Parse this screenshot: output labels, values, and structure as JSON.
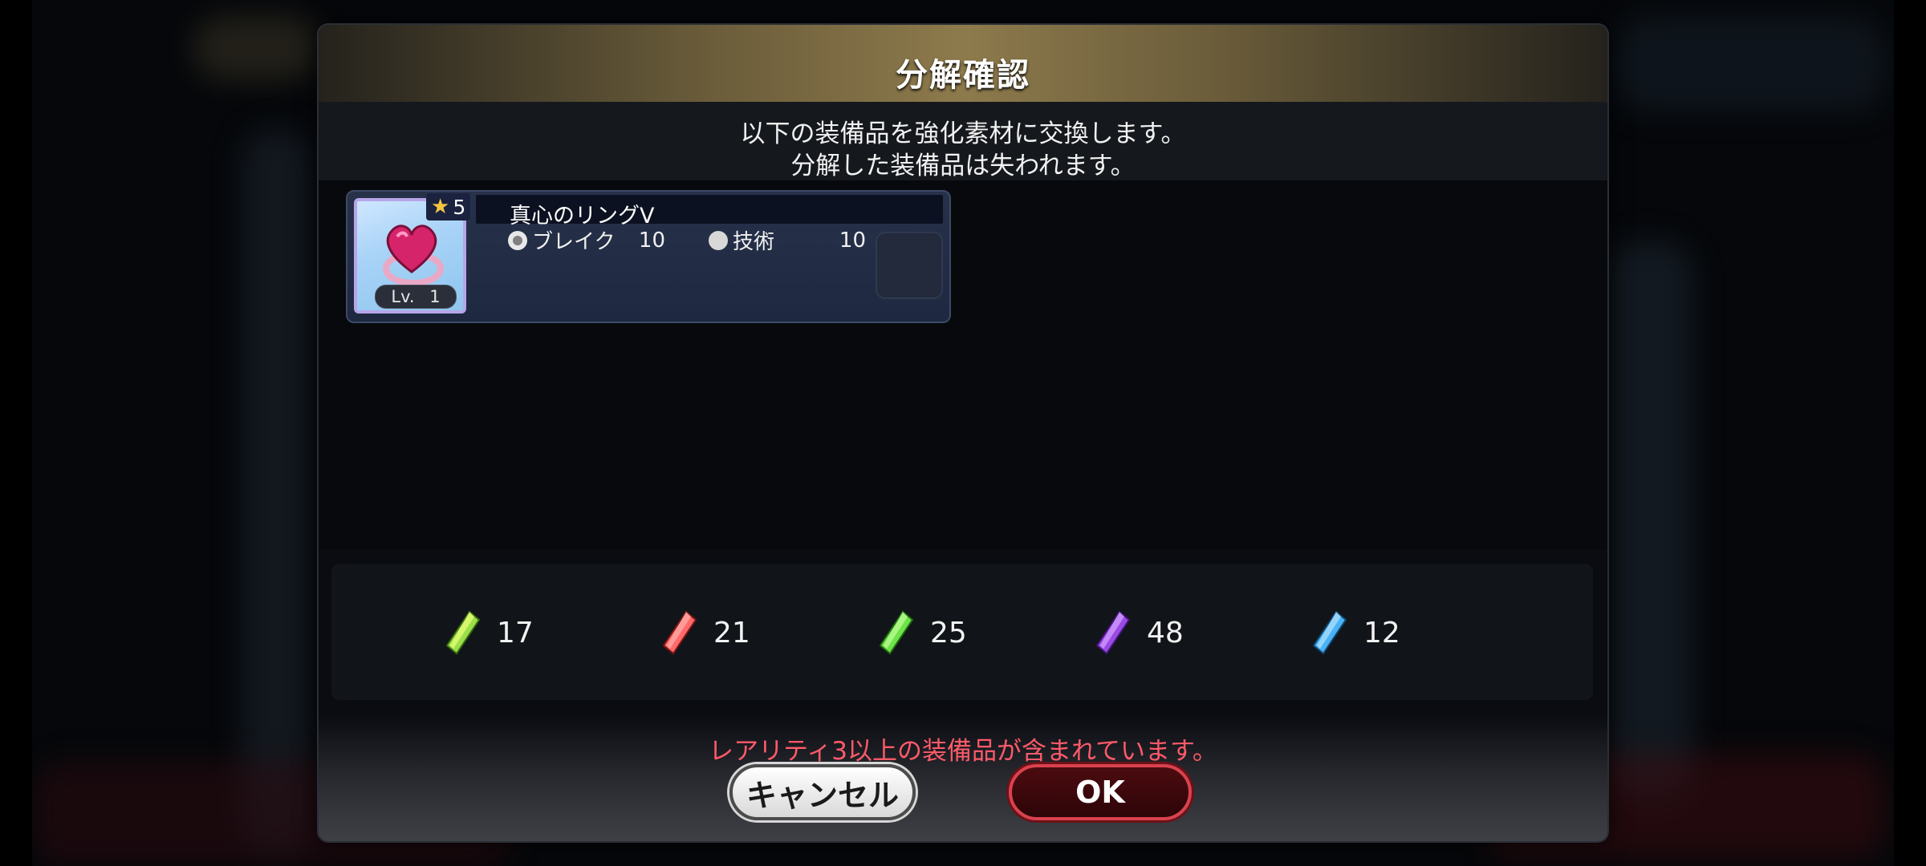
{
  "dialog": {
    "title": "分解確認",
    "message_line1": "以下の装備品を強化素材に交換します。",
    "message_line2": "分解した装備品は失われます。"
  },
  "equipment": {
    "rarity": "5",
    "name": "真心のリングV",
    "level_label": "Lv.",
    "level": "1",
    "stats": [
      {
        "label": "ブレイク",
        "value": "10",
        "icon": "burst-icon"
      },
      {
        "label": "技術",
        "value": "10",
        "icon": "bulb-icon"
      }
    ]
  },
  "materials": [
    {
      "qty": "17",
      "color": "#9be04a",
      "icon": "yellow-green-crystal-icon"
    },
    {
      "qty": "21",
      "color": "#ff6a6a",
      "icon": "red-crystal-icon"
    },
    {
      "qty": "25",
      "color": "#6fe24a",
      "icon": "green-crystal-icon"
    },
    {
      "qty": "48",
      "color": "#9b4ae6",
      "icon": "purple-crystal-icon"
    },
    {
      "qty": "12",
      "color": "#4ab2f5",
      "icon": "blue-crystal-icon"
    }
  ],
  "warning": "レアリティ3以上の装備品が含まれています。",
  "buttons": {
    "cancel": "キャンセル",
    "ok": "OK"
  }
}
